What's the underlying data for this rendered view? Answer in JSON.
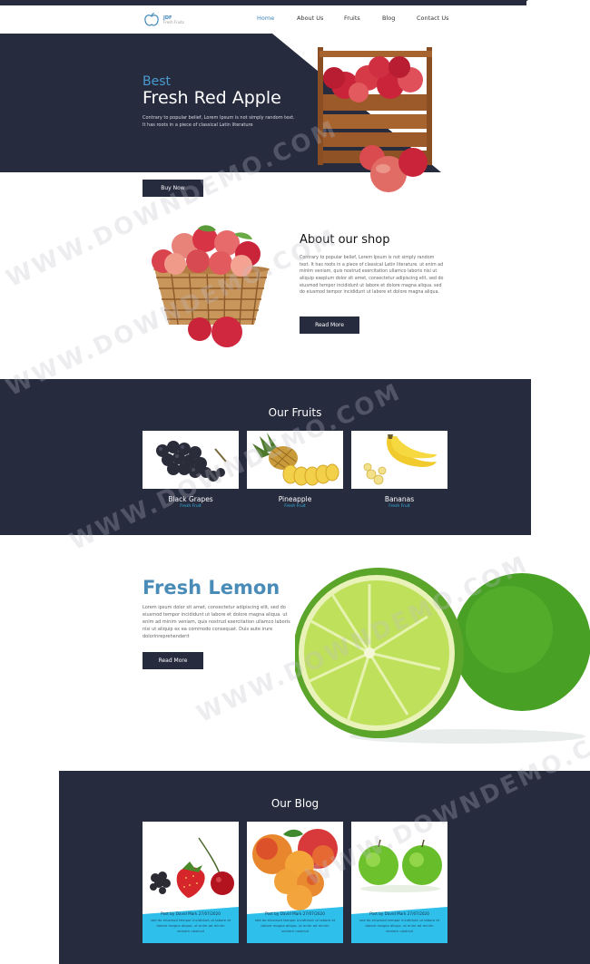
{
  "brand": {
    "name": "JDF",
    "tagline": "Fresh Fruits"
  },
  "nav": [
    {
      "label": "Home",
      "active": true
    },
    {
      "label": "About Us",
      "active": false
    },
    {
      "label": "Fruits",
      "active": false
    },
    {
      "label": "Blog",
      "active": false
    },
    {
      "label": "Contact Us",
      "active": false
    }
  ],
  "hero": {
    "eyebrow": "Best",
    "title": "Fresh Red Apple",
    "description": "Contrary to popular belief, Lorem Ipsum is not simply random text. It has roots in a piece of classical Latin literature",
    "button": "Buy Now"
  },
  "about": {
    "title": "About our shop",
    "description": "Contrary to popular belief, Lorem Ipsum is not simply random text. It has roots in a piece of classical Latin literature. ut enim ad minim veniam, quis nostrud exercitation ullamco laboris nisi ut aliquip exeplum dolor sit amet, consectetur adipiscing elit, sed do eiusmod tempor incididunt ut labore et dolore magna aliqua. sed do eiusmod tempor incididunt ut labore et dolore magna aliqua.",
    "button": "Read More"
  },
  "fruits": {
    "title": "Our Fruits",
    "items": [
      {
        "name": "Black Grapes",
        "sub": "Fresh Fruit"
      },
      {
        "name": "Pineapple",
        "sub": "Fresh Fruit"
      },
      {
        "name": "Bananas",
        "sub": "Fresh Fruit"
      }
    ]
  },
  "lemon": {
    "title": "Fresh Lemon",
    "description": "Lorem ipsum dolor sit amet, consectetur adipiscing elit, sed do eiusmod tempor incididunt ut labore et dolore magna aliqua. ut enim ad minim veniam, quis nostrud exercitation ullamco laboris nisi ut aliquip ex ea commodo consequat. Duis aute irure dolorinreprehenderit",
    "button": "Read More"
  },
  "blog": {
    "title": "Our Blog",
    "posts": [
      {
        "meta": "Post by David Mark 27/07/2020",
        "text": "sed do eiusmod tempor incididunt ut labore et dolore magna aliqua. ut enim ad minim veniam nostrud"
      },
      {
        "meta": "Post by David Mark 27/07/2020",
        "text": "sed do eiusmod tempor incididunt ut labore et dolore magna aliqua. ut enim ad minim veniam nostrud"
      },
      {
        "meta": "Post by David Mark 27/07/2020",
        "text": "sed do eiusmod tempor incididunt ut labore et dolore magna aliqua. ut enim ad minim veniam nostrud"
      }
    ]
  },
  "watermark": "WWW.DOWNDEMO.COM",
  "colors": {
    "dark": "#262b3e",
    "accent": "#4a9bd1",
    "cyan": "#2ec0ea",
    "lemon_title": "#4a8cb8"
  }
}
